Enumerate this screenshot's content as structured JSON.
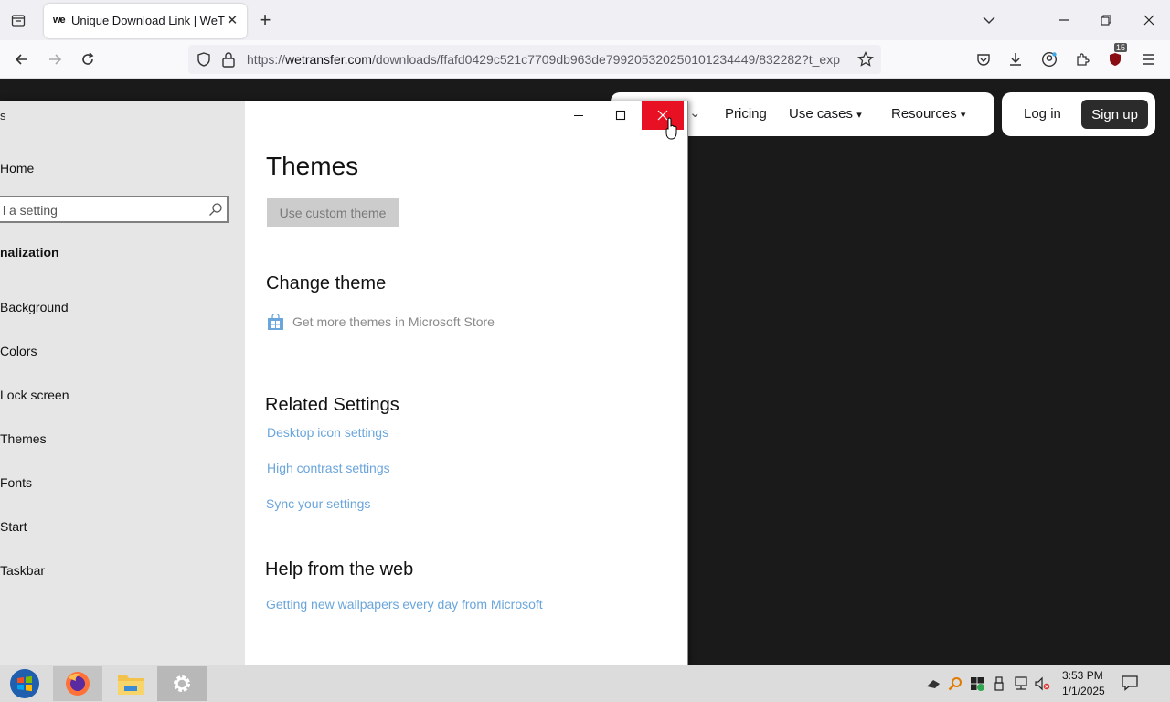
{
  "browser": {
    "tab": {
      "title": "Unique Download Link | WeTransfer",
      "favicon_text": "we"
    },
    "url": {
      "prefix": "https://",
      "domain": "wetransfer.com",
      "path": "/downloads/ffafd0429c521c7709db963de799205320250101234449/832282?t_exp"
    },
    "extensions_badge": "15"
  },
  "site": {
    "nav": {
      "pricing": "Pricing",
      "use_cases": "Use cases",
      "resources": "Resources",
      "partial_chevron": "⌄"
    },
    "auth": {
      "login": "Log in",
      "signup": "Sign up"
    }
  },
  "settings": {
    "sidebar": {
      "app_title": "s",
      "home": "Home",
      "search_placeholder": "l a setting",
      "section": "nalization",
      "items": [
        "Background",
        "Colors",
        "Lock screen",
        "Themes",
        "Fonts",
        "Start",
        "Taskbar"
      ]
    },
    "main": {
      "heading": "Themes",
      "custom_theme_button": "Use custom theme",
      "change_theme_heading": "Change theme",
      "store_link": "Get more themes in Microsoft Store",
      "related_heading": "Related Settings",
      "related_links": [
        "Desktop icon settings",
        "High contrast settings",
        "Sync your settings"
      ],
      "help_heading": "Help from the web",
      "help_link": "Getting new wallpapers every day from Microsoft"
    }
  },
  "taskbar": {
    "time": "3:53 PM",
    "date": "1/1/2025"
  },
  "colors": {
    "close_red": "#e81123",
    "link_blue": "#6aa5dc",
    "page_bg": "#1a1a1a"
  }
}
